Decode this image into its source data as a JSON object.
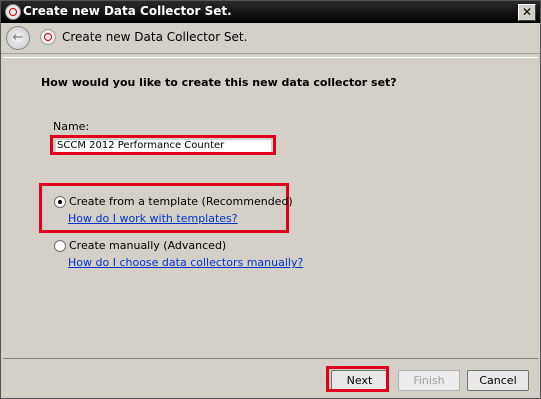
{
  "window": {
    "title": "Create new Data Collector Set.",
    "close_glyph": "✕"
  },
  "header": {
    "back_glyph": "←",
    "title": "Create new Data Collector Set."
  },
  "main": {
    "question": "How would you like to create this new data collector set?",
    "name_label": "Name:",
    "name_value": "SCCM 2012 Performance Counter",
    "options": [
      {
        "label": "Create from a template (Recommended)",
        "help_link": "How do I work with templates?",
        "selected": true
      },
      {
        "label": "Create manually (Advanced)",
        "help_link": "How do I choose data collectors manually?",
        "selected": false
      }
    ]
  },
  "buttons": {
    "next": "Next",
    "finish": "Finish",
    "cancel": "Cancel"
  },
  "colors": {
    "highlight": "#e0001b",
    "link": "#0033cc",
    "face": "#d4d0c8"
  }
}
